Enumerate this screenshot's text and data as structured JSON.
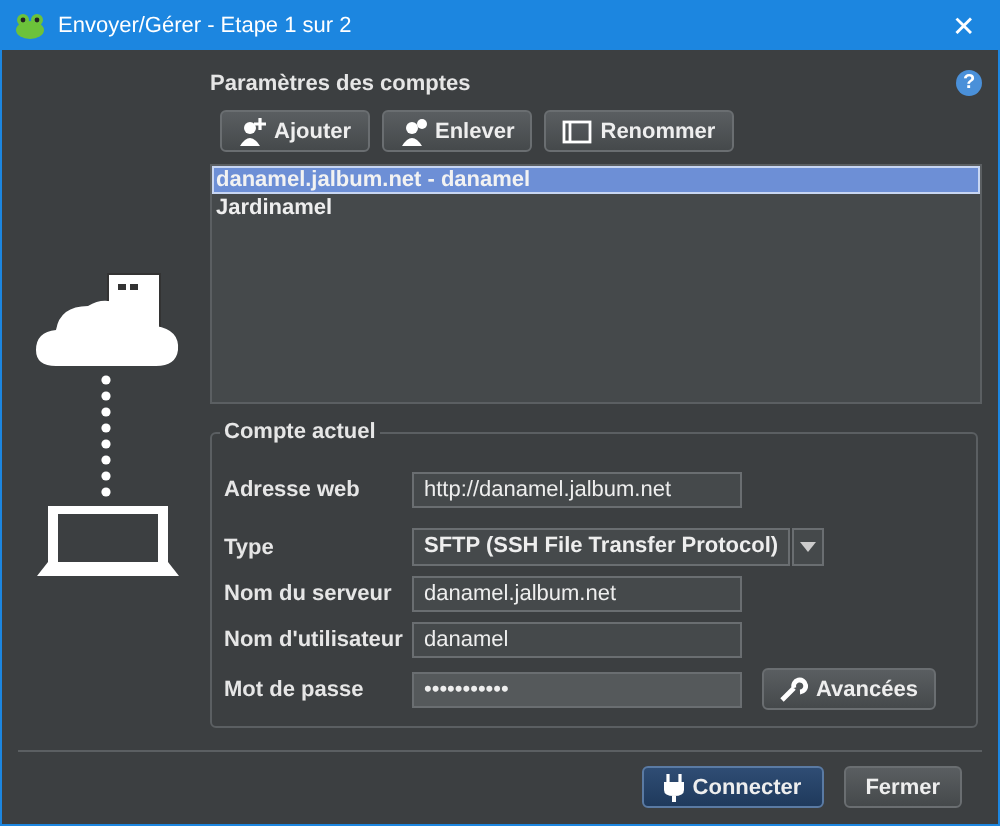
{
  "window": {
    "title": "Envoyer/Gérer - Etape 1 sur 2",
    "close": "✕",
    "help": "?"
  },
  "accounts": {
    "heading": "Paramètres des comptes",
    "toolbar": [
      {
        "label": "Ajouter",
        "kind": "add"
      },
      {
        "label": "Enlever",
        "kind": "remove"
      },
      {
        "label": "Renommer",
        "kind": "rename"
      }
    ],
    "items": [
      {
        "label": "danamel.jalbum.net - danamel",
        "selected": true
      },
      {
        "label": "Jardinamel",
        "selected": false
      }
    ]
  },
  "current": {
    "legend": "Compte actuel",
    "fields": [
      {
        "label": "Adresse web",
        "value": "http://danamel.jalbum.net",
        "kind": "text"
      },
      {
        "label": "Type",
        "value": "SFTP (SSH File Transfer Protocol)",
        "kind": "select"
      },
      {
        "label": "Nom du serveur",
        "value": "danamel.jalbum.net",
        "kind": "text"
      },
      {
        "label": "Nom d'utilisateur",
        "value": "danamel",
        "kind": "text"
      },
      {
        "label": "Mot de passe",
        "value": "•••••••••••",
        "kind": "password",
        "button": "Avancées"
      }
    ]
  },
  "footer": [
    {
      "label": "Connecter",
      "kind": "primary"
    },
    {
      "label": "Fermer",
      "kind": "secondary"
    }
  ]
}
